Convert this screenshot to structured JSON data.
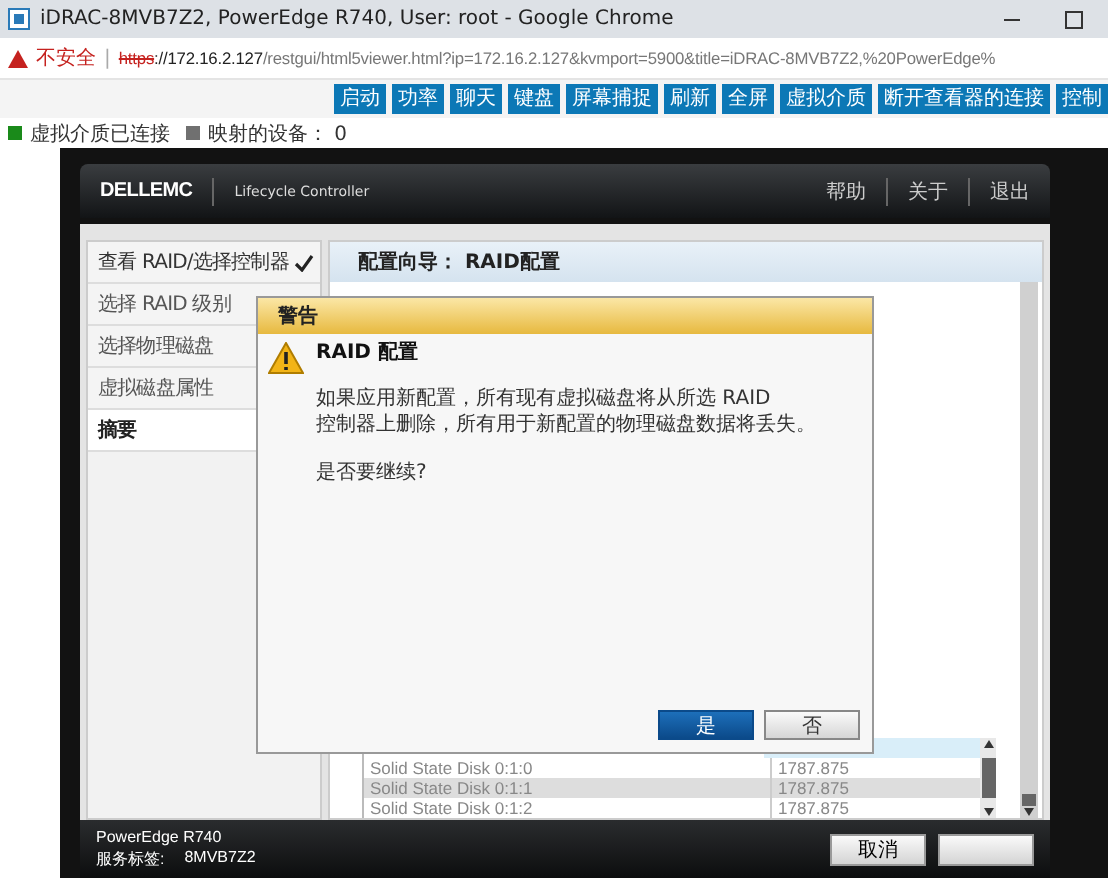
{
  "window": {
    "title": "iDRAC-8MVB7Z2, PowerEdge R740, User: root - Google Chrome"
  },
  "address_bar": {
    "security": "不安全",
    "separator": "|",
    "scheme": "https",
    "host": "://172.16.2.127",
    "path": "/restgui/html5viewer.html?ip=172.16.2.127&kvmport=5900&title=iDRAC-8MVB7Z2,%20PowerEdge%"
  },
  "toolbar": [
    "启动",
    "功率",
    "聊天",
    "键盘",
    "屏幕捕捉",
    "刷新",
    "全屏",
    "虚拟介质",
    "断开查看器的连接",
    "控制"
  ],
  "status": [
    {
      "label": "虚拟介质已连接",
      "color": "#1a8a1a"
    },
    {
      "label": "映射的设备： 0",
      "color": "#707070"
    }
  ],
  "lc": {
    "logo": "DELLEMC",
    "product": "Lifecycle Controller",
    "links": [
      "帮助",
      "关于",
      "退出"
    ],
    "nav": [
      {
        "label": "查看 RAID/选择控制器",
        "done": true,
        "selected": false
      },
      {
        "label": "选择 RAID 级别",
        "done": false,
        "selected": false
      },
      {
        "label": "选择物理磁盘",
        "done": false,
        "selected": false
      },
      {
        "label": "虚拟磁盘属性",
        "done": false,
        "selected": false
      },
      {
        "label": "摘要",
        "done": false,
        "selected": true
      }
    ],
    "content_title": "配置向导： RAID配置",
    "rows": [
      {
        "name": "Solid State Disk 0:1:0",
        "size": "1787.875",
        "selected": false
      },
      {
        "name": "Solid State Disk 0:1:1",
        "size": "1787.875",
        "selected": true
      },
      {
        "name": "Solid State Disk 0:1:2",
        "size": "1787.875",
        "selected": false
      }
    ],
    "footer": {
      "model": "PowerEdge R740",
      "tag_label": "服务标签:",
      "tag": "8MVB7Z2",
      "buttons": [
        "取消"
      ]
    }
  },
  "dialog": {
    "title": "警告",
    "heading": "RAID 配置",
    "message": [
      "如果应用新配置，所有现有虚拟磁盘将从所选 RAID",
      "控制器上删除，所有用于新配置的物理磁盘数据将丢失。"
    ],
    "question": "是否要继续?",
    "buttons": [
      {
        "label": "是",
        "kind": "primary"
      },
      {
        "label": "否",
        "kind": "secondary"
      }
    ]
  }
}
